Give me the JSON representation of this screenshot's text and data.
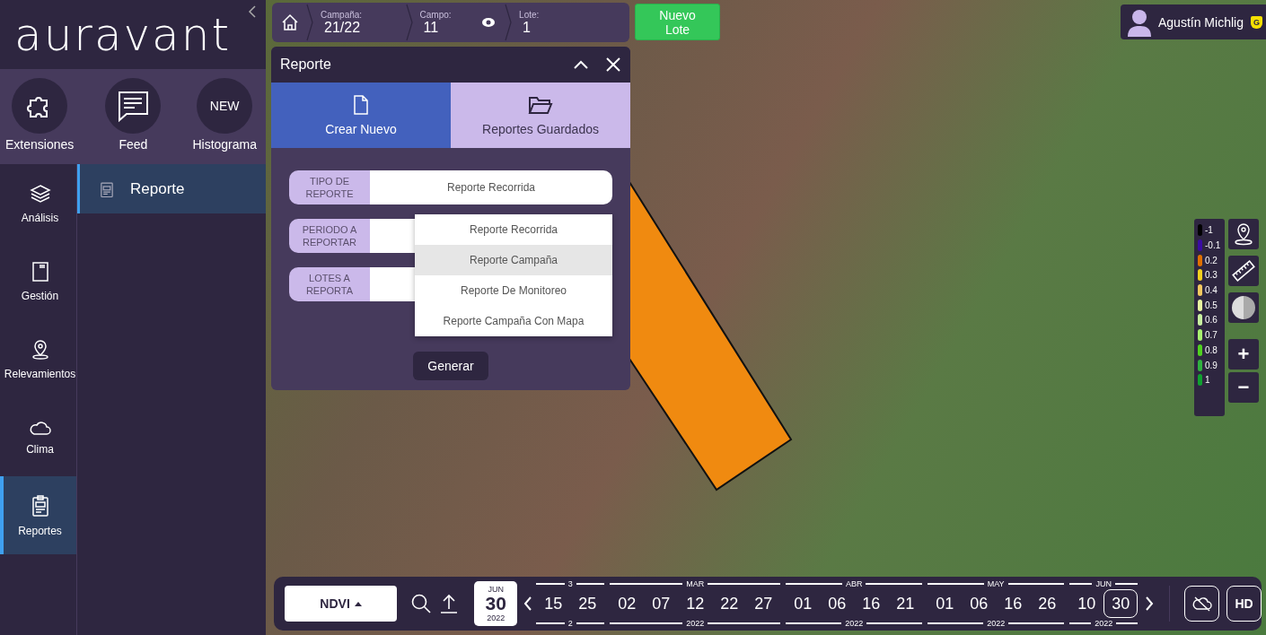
{
  "app": {
    "logo": "auravant"
  },
  "shortcuts": [
    {
      "label": "Extensiones",
      "kind": "puzzle"
    },
    {
      "label": "Feed",
      "kind": "chat"
    },
    {
      "label": "Histograma",
      "kind": "badge",
      "badge": "NEW"
    }
  ],
  "nav": [
    {
      "label": "Análisis",
      "kind": "layers",
      "selected": false
    },
    {
      "label": "Gestión",
      "kind": "book",
      "selected": false
    },
    {
      "label": "Relevamientos",
      "kind": "pin",
      "selected": false
    },
    {
      "label": "Clima",
      "kind": "cloud",
      "selected": false
    },
    {
      "label": "Reportes",
      "kind": "clipboard",
      "selected": true
    }
  ],
  "subnav": [
    {
      "label": "Reporte",
      "selected": true
    }
  ],
  "breadcrumb": [
    {
      "label": "Campaña:",
      "value": "21/22"
    },
    {
      "label": "Campo:",
      "value": "11"
    },
    {
      "label": "Lote:",
      "value": "1"
    }
  ],
  "new_lot_button": "Nuevo Lote",
  "report_panel": {
    "title": "Reporte",
    "tabs": [
      {
        "label": "Crear Nuevo",
        "kind": "file",
        "selected": true
      },
      {
        "label": "Reportes Guardados",
        "kind": "folder",
        "selected": false
      }
    ],
    "fields": [
      {
        "label": "TIPO DE REPORTE",
        "value": "Reporte Recorrida"
      },
      {
        "label": "PERIODO A REPORTAR"
      },
      {
        "label": "LOTES A REPORTA"
      }
    ],
    "dropdown_options": [
      {
        "label": "Reporte Recorrida",
        "hovered": false
      },
      {
        "label": "Reporte Campaña",
        "hovered": true
      },
      {
        "label": "Reporte De Monitoreo",
        "hovered": false
      },
      {
        "label": "Reporte Campaña Con Mapa",
        "hovered": false
      }
    ],
    "generate_button": "Generar"
  },
  "user": {
    "name": "Agustín Michlig",
    "badge": "G"
  },
  "legend": [
    {
      "label": "-1",
      "color": "#000000"
    },
    {
      "label": "-0.1",
      "color": "#3a0ca3"
    },
    {
      "label": "0.2",
      "color": "#e07000"
    },
    {
      "label": "0.3",
      "color": "#f5d020"
    },
    {
      "label": "0.4",
      "color": "#f5c860"
    },
    {
      "label": "0.5",
      "color": "#e8f5a0"
    },
    {
      "label": "0.6",
      "color": "#c8f0a0"
    },
    {
      "label": "0.7",
      "color": "#a8f070"
    },
    {
      "label": "0.8",
      "color": "#50d020"
    },
    {
      "label": "0.9",
      "color": "#30b040"
    },
    {
      "label": "1",
      "color": "#10a030"
    }
  ],
  "zoom_controls": [
    "+",
    "−"
  ],
  "timeline": {
    "index": "NDVI",
    "date": {
      "month": "JUN",
      "day": "30",
      "year": "2022"
    },
    "groups": [
      {
        "month": "3",
        "year": "2",
        "days": [
          {
            "label": "15",
            "selected": false
          },
          {
            "label": "25",
            "selected": false
          }
        ]
      },
      {
        "month": "MAR",
        "year": "2022",
        "days": [
          {
            "label": "02",
            "selected": false
          },
          {
            "label": "07",
            "selected": false
          },
          {
            "label": "12",
            "selected": false
          },
          {
            "label": "22",
            "selected": false
          },
          {
            "label": "27",
            "selected": false
          }
        ]
      },
      {
        "month": "ABR",
        "year": "2022",
        "days": [
          {
            "label": "01",
            "selected": false
          },
          {
            "label": "06",
            "selected": false
          },
          {
            "label": "16",
            "selected": false
          },
          {
            "label": "21",
            "selected": false
          }
        ]
      },
      {
        "month": "MAY",
        "year": "2022",
        "days": [
          {
            "label": "01",
            "selected": false
          },
          {
            "label": "06",
            "selected": false
          },
          {
            "label": "16",
            "selected": false
          },
          {
            "label": "26",
            "selected": false
          }
        ]
      },
      {
        "month": "JUN",
        "year": "2022",
        "days": [
          {
            "label": "10",
            "selected": false
          },
          {
            "label": "30",
            "selected": true
          }
        ]
      }
    ],
    "hd_button": "HD"
  }
}
